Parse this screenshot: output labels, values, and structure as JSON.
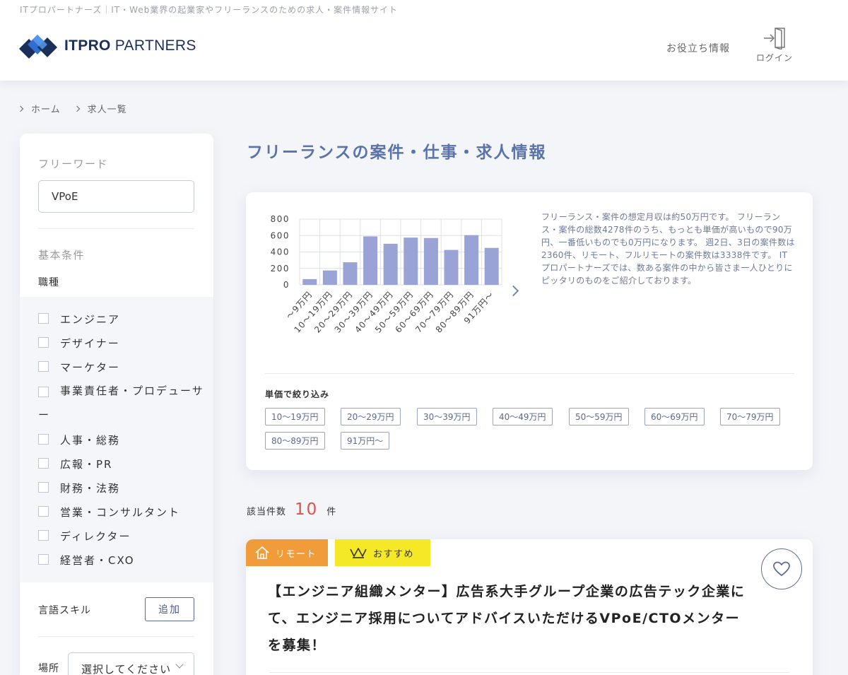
{
  "header": {
    "tagline": "ITプロパートナーズ｜IT・Web業界の起業家やフリーランスのための求人・案件情報サイト",
    "logo_bold": "ITPRO",
    "logo_rest": " PARTNERS",
    "nav_info": "お役立ち情報",
    "login_label": "ログイン"
  },
  "breadcrumb": {
    "items": [
      "ホーム",
      "求人一覧"
    ]
  },
  "sidebar": {
    "freeword_label": "フリーワード",
    "freeword_value": "VPoE",
    "basic_label": "基本条件",
    "job_type_label": "職種",
    "categories": [
      "エンジニア",
      "デザイナー",
      "マーケター",
      "事業責任者・プロデューサー",
      "人事・総務",
      "広報・PR",
      "財務・法務",
      "営業・コンサルタント",
      "ディレクター",
      "経営者・CXO"
    ],
    "lang_label": "言語スキル",
    "add_label": "追加",
    "place_label": "場所",
    "place_select": "選択してください"
  },
  "main": {
    "title": "フリーランスの案件・仕事・求人情報",
    "summary": "フリーランス・案件の想定月収は約50万円です。 フリーランス・案件の総数4278件のうち、もっとも単価が高いもので90万円、一番低いものでも0万円になります。 週2日、3日の案件数は2360件、リモート、フルリモートの案件数は3338件です。 ITプロパートナーズでは、数ある案件の中から皆さま一人ひとりにピッタリのものをご紹介しております。",
    "filter_title": "単価で絞り込み",
    "price_filters": [
      "10〜19万円",
      "20〜29万円",
      "30〜39万円",
      "40〜49万円",
      "50〜59万円",
      "60〜69万円",
      "70〜79万円",
      "80〜89万円",
      "91万円〜"
    ],
    "count_prefix": "該当件数",
    "count_value": "10",
    "count_suffix": "件"
  },
  "job": {
    "tag_remote": "リモート",
    "tag_recommend": "おすすめ",
    "title": "【エンジニア組織メンター】広告系大手グループ企業の広告テック企業にて、エンジニア採用についてアドバイスいただけるVPoE/CTOメンターを募集！"
  },
  "colors": {
    "bar": "#9aa3d6",
    "title_blue": "#5a73a8",
    "remote_tag": "#f09c3a",
    "recommend_tag": "#f5e827",
    "count_red": "#e0504a"
  },
  "chart_data": {
    "type": "bar",
    "categories": [
      "〜9万円",
      "10〜19万円",
      "20〜29万円",
      "30〜39万円",
      "40〜49万円",
      "50〜59万円",
      "60〜69万円",
      "70〜79万円",
      "80〜89万円",
      "91万円〜"
    ],
    "values": [
      70,
      175,
      275,
      590,
      500,
      575,
      570,
      425,
      605,
      450
    ],
    "yticks": [
      0,
      200,
      400,
      600,
      800
    ],
    "ylim": [
      0,
      800
    ],
    "grid": true
  }
}
